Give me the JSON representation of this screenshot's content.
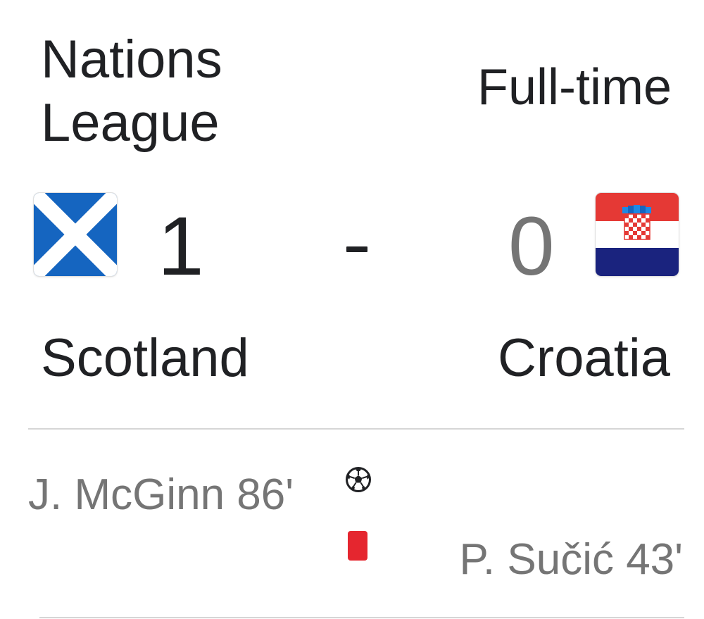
{
  "match": {
    "competition": "Nations League",
    "status": "Full-time",
    "home": {
      "team": "Scotland",
      "score": "1",
      "flag_icon": "scotland-flag-icon",
      "colors": {
        "blue": "#1565c0",
        "white": "#ffffff"
      }
    },
    "away": {
      "team": "Croatia",
      "score": "0",
      "flag_icon": "croatia-flag-icon",
      "colors": {
        "red": "#e53935",
        "white": "#ffffff",
        "blue": "#1a237e"
      }
    },
    "separator": "-"
  },
  "events": {
    "home_goal": {
      "player_text": "J. McGinn 86'",
      "icon": "soccer-ball-icon"
    },
    "away_red_card": {
      "player_text": "P. Sučić 43'",
      "icon": "red-card-icon",
      "color": "#e5262f"
    }
  }
}
